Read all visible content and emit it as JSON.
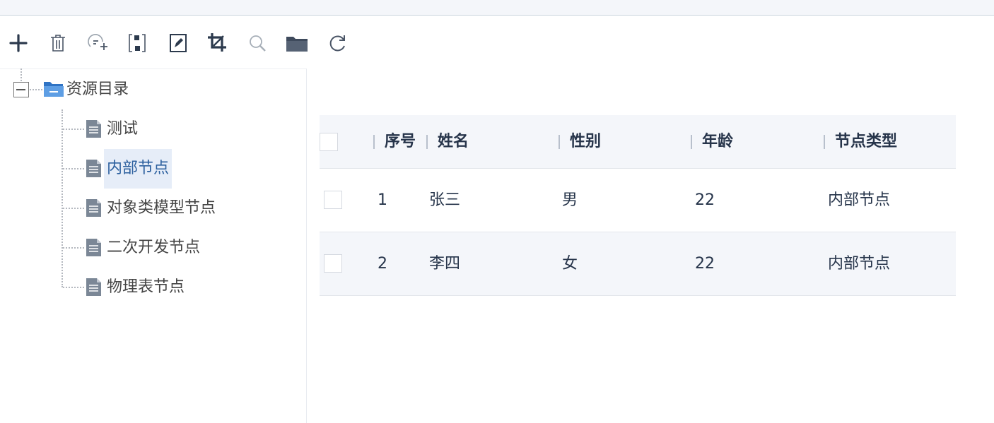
{
  "toolbar": {
    "icons": [
      "add-icon",
      "delete-icon",
      "add-group-icon",
      "resize-icon",
      "edit-icon",
      "crop-icon",
      "search-icon",
      "folder-icon",
      "refresh-icon"
    ]
  },
  "tree": {
    "root": {
      "label": "资源目录",
      "expanded": true
    },
    "children": [
      {
        "label": "测试"
      },
      {
        "label": "内部节点",
        "selected": true
      },
      {
        "label": "对象类模型节点"
      },
      {
        "label": "二次开发节点"
      },
      {
        "label": "物理表节点"
      }
    ]
  },
  "grid": {
    "columns": [
      "序号",
      "姓名",
      "性别",
      "年龄",
      "节点类型"
    ],
    "rows": [
      [
        "1",
        "张三",
        "男",
        "22",
        "内部节点"
      ],
      [
        "2",
        "李四",
        "女",
        "22",
        "内部节点"
      ]
    ]
  },
  "colors": {
    "header_bg": "#f4f6fa",
    "selected_bg": "#e6edf8",
    "selected_text": "#2b5f9e",
    "folder_blue": "#4a8fd6",
    "header_text": "#26344a"
  }
}
